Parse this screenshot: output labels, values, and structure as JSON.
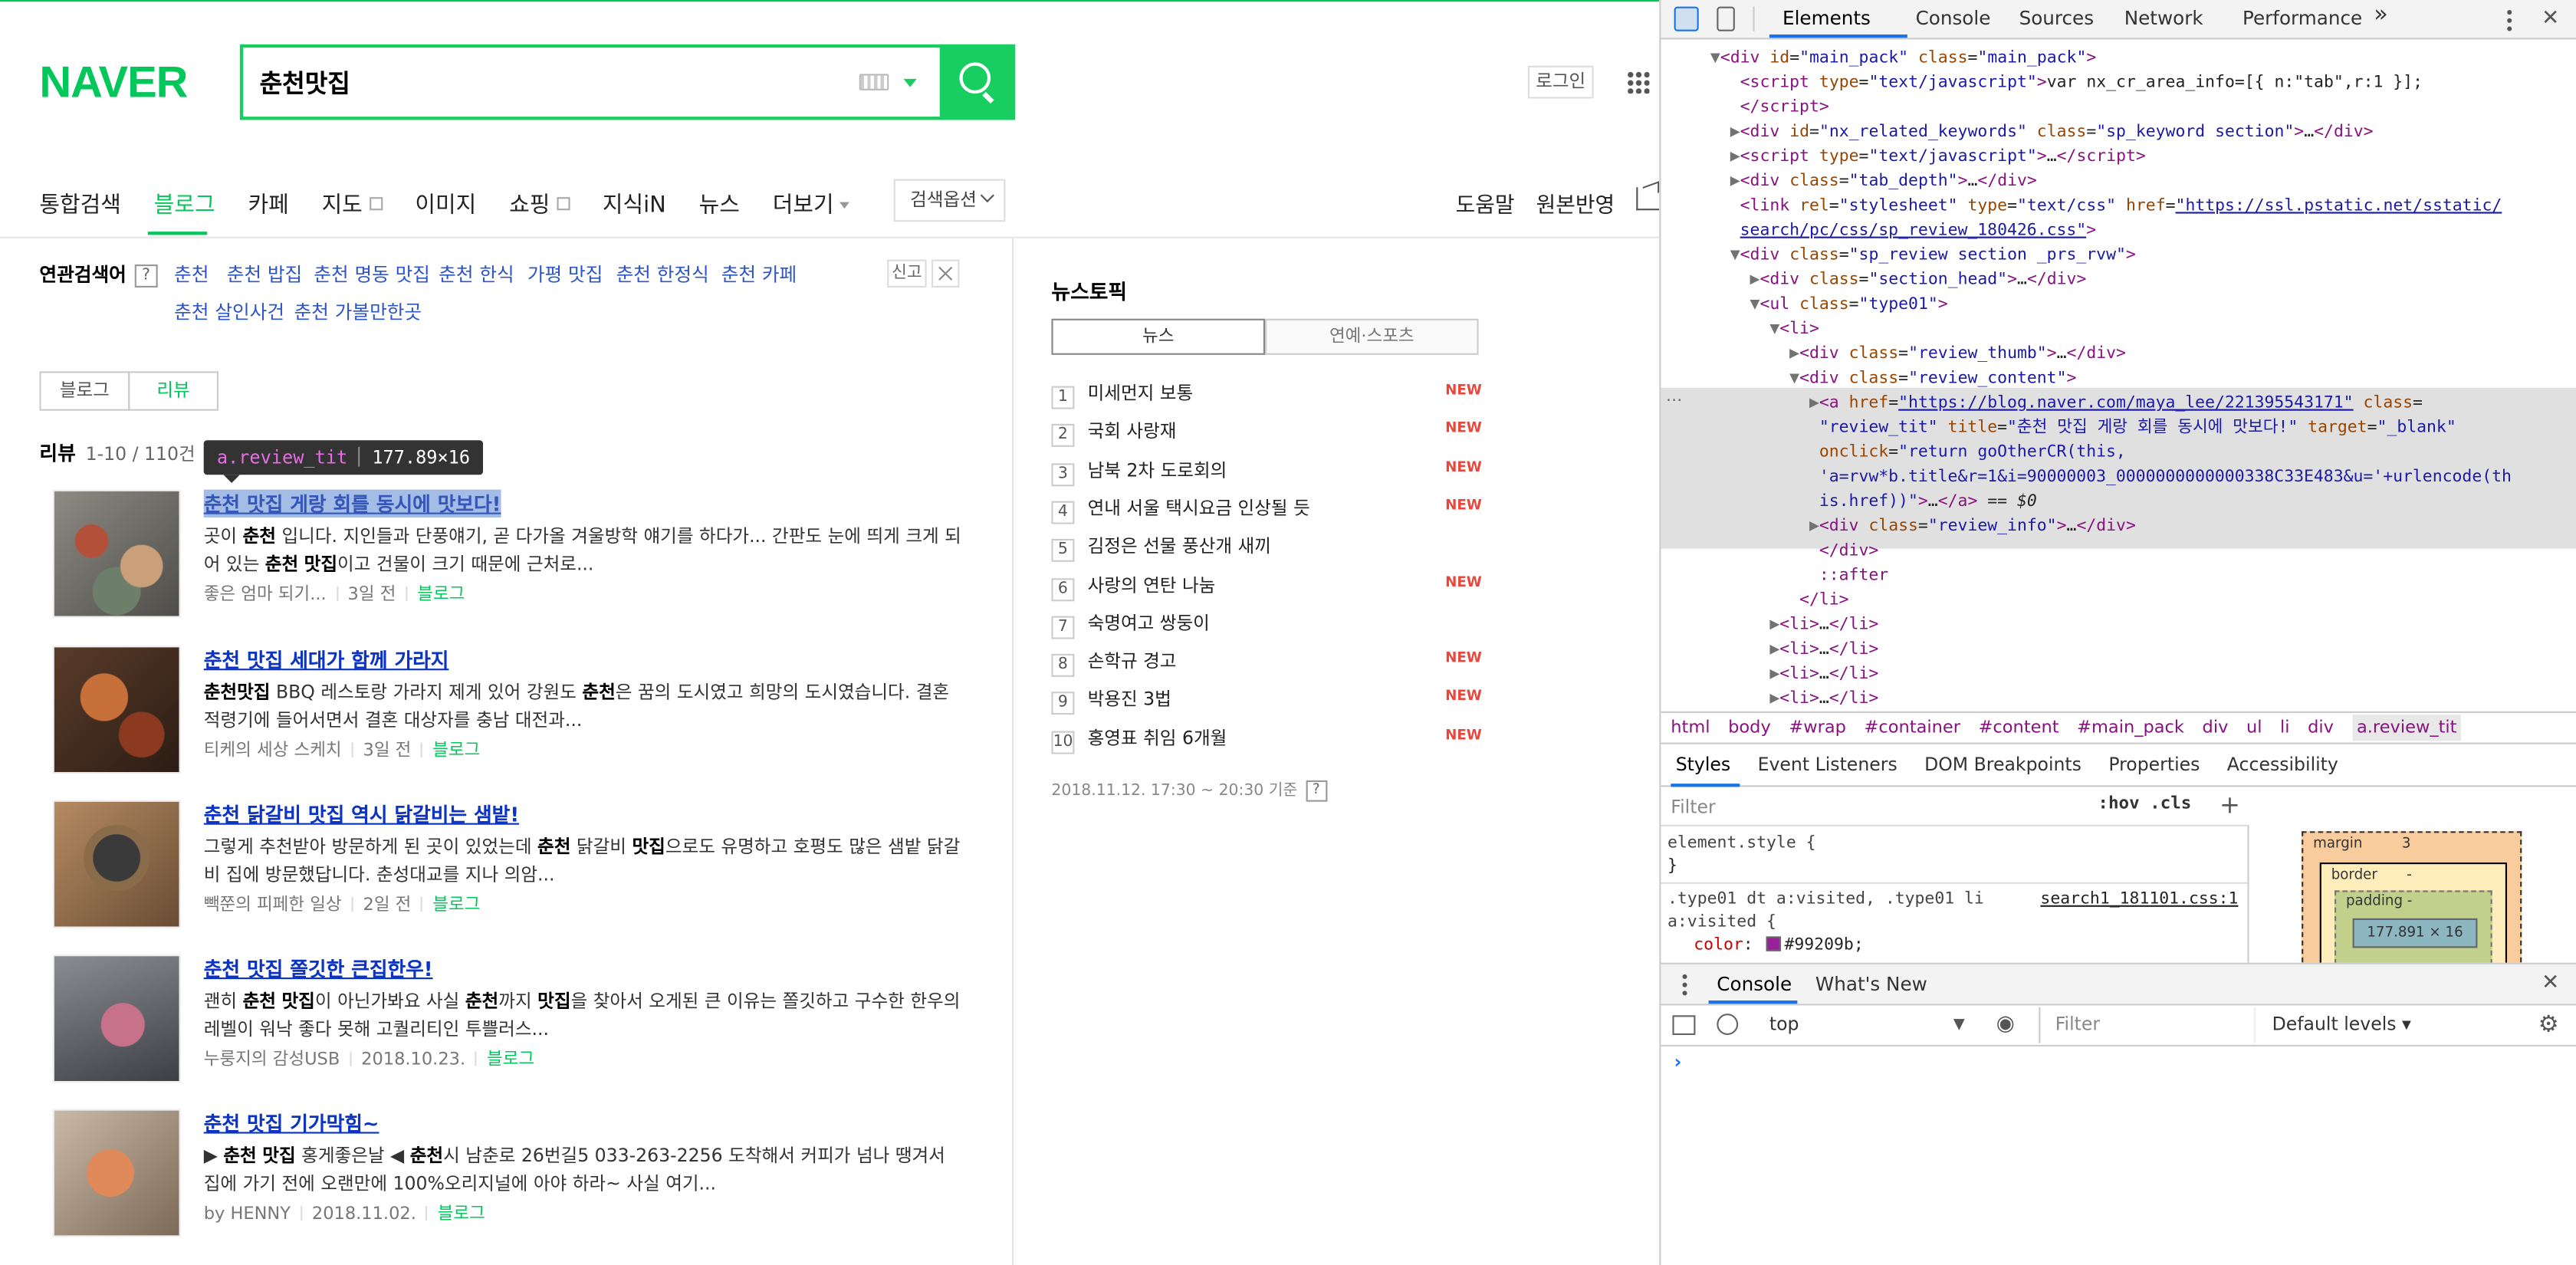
{
  "naver": {
    "logo": "NAVER",
    "query": "춘천맛집",
    "login": "로그인",
    "tabs": [
      "통합검색",
      "블로그",
      "카페",
      "지도",
      "이미지",
      "쇼핑",
      "지식iN",
      "뉴스",
      "더보기"
    ],
    "search_options": "검색옵션",
    "help": "도움말",
    "original": "원본반영",
    "related_title": "연관검색어",
    "related": [
      "춘천",
      "춘천 밥집",
      "춘천 명동 맛집",
      "춘천 한식",
      "가평 맛집",
      "춘천 한정식",
      "춘천 카페",
      "춘천 살인사건",
      "춘천 가볼만한곳"
    ],
    "report": "신고",
    "seg_blog": "블로그",
    "seg_review": "리뷰",
    "count_label": "리뷰",
    "count_value": "1-10 / 110건",
    "tooltip_tag": "a.review_tit",
    "tooltip_size": "177.89×16",
    "results": [
      {
        "title": "춘천 맛집 게랑 회를 동시에 맛보다!",
        "desc": "곳이 춘천 입니다. 지인들과 단풍얘기, 곧 다가올 겨울방학 얘기를 하다가... 간판도 눈에 띄게 크게 되어 있는 춘천 맛집이고 건물이 크기 때문에 근처로...",
        "author": "좋은 엄마 되기...",
        "date": "3일 전",
        "source": "블로그"
      },
      {
        "title": "춘천 맛집 세대가 함께 가라지",
        "desc": "춘천맛집 BBQ 레스토랑 가라지 제게 있어 강원도 춘천은 꿈의 도시였고 희망의 도시였습니다. 결혼 적령기에 들어서면서 결혼 대상자를 충남 대전과...",
        "author": "티케의 세상 스케치",
        "date": "3일 전",
        "source": "블로그"
      },
      {
        "title": "춘천 닭갈비 맛집 역시 닭갈비는 샘밭!",
        "desc": "그렇게 추천받아 방문하게 된 곳이 있었는데 춘천 닭갈비 맛집으로도 유명하고 호평도 많은 샘밭 닭갈비 집에 방문했답니다. 춘성대교를 지나 의암...",
        "author": "빽쭌의 피페한 일상",
        "date": "2일 전",
        "source": "블로그"
      },
      {
        "title": "춘천 맛집 쫄깃한 큰집한우!",
        "desc": "괜히 춘천 맛집이 아닌가봐요 사실 춘천까지 맛집을 찾아서 오게된 큰 이유는 쫄깃하고 구수한 한우의 레벨이 워낙 좋다 못해 고퀄리티인 투쁠러스...",
        "author": "누룽지의 감성USB",
        "date": "2018.10.23.",
        "source": "블로그"
      },
      {
        "title": "춘천 맛집 기가막힘~",
        "desc": "▶ 춘천 맛집 홍게좋은날 ◀ 춘천시 남춘로 26번길5 033-263-2256 도착해서 커피가 넘나 땡겨서 집에 가기 전에 오랜만에 100%오리지널에 아야 하라~ 사실 여기...",
        "author": "by HENNY",
        "date": "2018.11.02.",
        "source": "블로그"
      }
    ],
    "news_title": "뉴스토픽",
    "news_tabs": [
      "뉴스",
      "연예·스포츠"
    ],
    "news": [
      {
        "n": "1",
        "t": "미세먼지 보통",
        "new": "NEW"
      },
      {
        "n": "2",
        "t": "국회 사랑재",
        "new": "NEW"
      },
      {
        "n": "3",
        "t": "남북 2차 도로회의",
        "new": "NEW"
      },
      {
        "n": "4",
        "t": "연내 서울 택시요금 인상될 듯",
        "new": "NEW"
      },
      {
        "n": "5",
        "t": "김정은 선물 풍산개 새끼",
        "new": ""
      },
      {
        "n": "6",
        "t": "사랑의 연탄 나눔",
        "new": "NEW"
      },
      {
        "n": "7",
        "t": "숙명여고 쌍둥이",
        "new": ""
      },
      {
        "n": "8",
        "t": "손학규 경고",
        "new": "NEW"
      },
      {
        "n": "9",
        "t": "박용진 3법",
        "new": "NEW"
      },
      {
        "n": "10",
        "t": "홍영표 취임 6개월",
        "new": "NEW"
      }
    ],
    "news_footer": "2018.11.12. 17:30 ~ 20:30 기준"
  },
  "devtools": {
    "tabs": [
      "Elements",
      "Console",
      "Sources",
      "Network",
      "Performance"
    ],
    "more": "»",
    "breadcrumb": [
      "html",
      "body",
      "#wrap",
      "#container",
      "#content",
      "#main_pack",
      "div",
      "ul",
      "li",
      "div",
      "a.review_tit"
    ],
    "style_tabs": [
      "Styles",
      "Event Listeners",
      "DOM Breakpoints",
      "Properties",
      "Accessibility"
    ],
    "filter": "Filter",
    "hov_cls": ":hov  .cls",
    "element_style": "element.style {",
    "brace": "}",
    "rule_selector": ".type01 dt a:visited, .type01 li",
    "rule_selector2": "a:visited {",
    "rule_source": "search1_181101.css:1",
    "rule_prop": "color",
    "rule_value": "#99209b",
    "box_margin": "margin",
    "box_margin_val": "3",
    "box_border": "border",
    "box_border_val": "-",
    "box_padding": "padding -",
    "box_content": "177.891 × 16",
    "console_tabs": [
      "Console",
      "What's New"
    ],
    "context": "top",
    "console_filter": "Filter",
    "levels": "Default levels",
    "prompt": "›",
    "accent": "#1a73e8"
  }
}
